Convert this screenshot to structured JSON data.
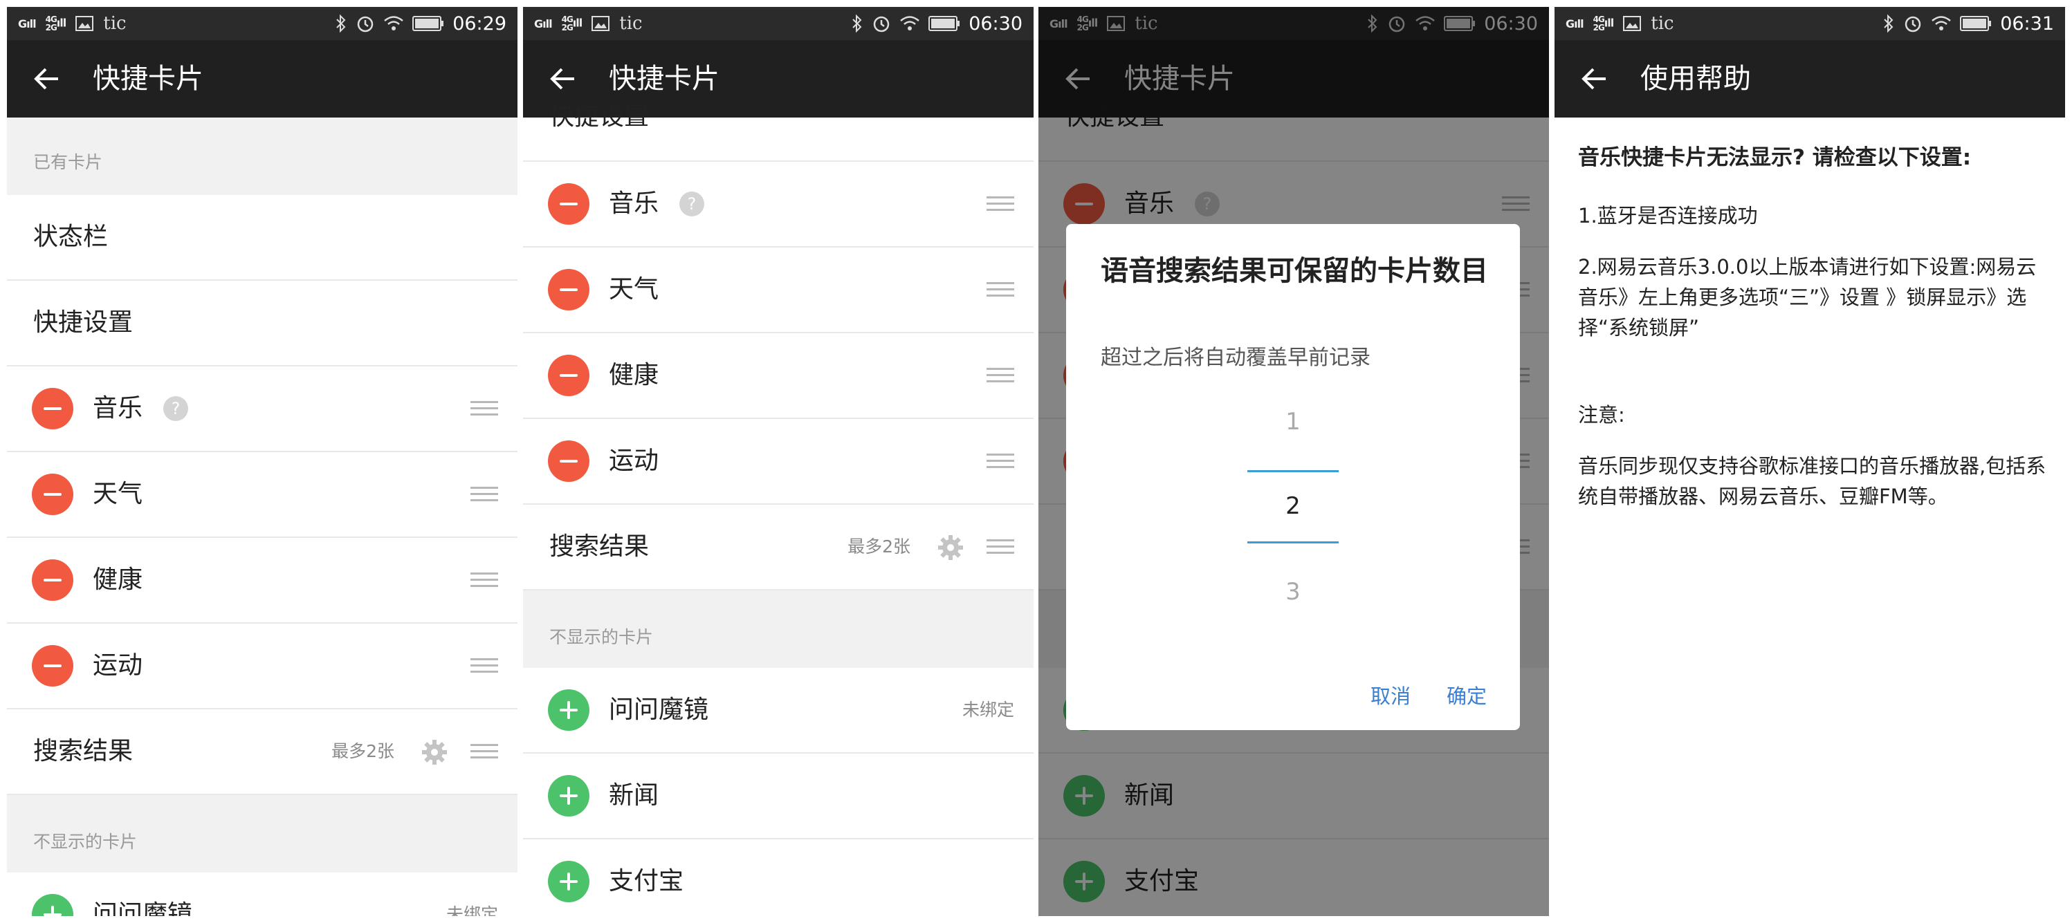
{
  "status_bar": {
    "carrier": "tic",
    "signal_label_1": "Gill",
    "signal_label_2": "4G",
    "signal_label_3": "2G"
  },
  "panel1": {
    "time": "06:29",
    "title": "快捷卡片",
    "section_existing": "已有卡片",
    "row_statusbar": "状态栏",
    "row_quick": "快捷设置",
    "cards": [
      "音乐",
      "天气",
      "健康",
      "运动"
    ],
    "help_mark": "?",
    "search_label": "搜索结果",
    "search_max": "最多2张",
    "section_hidden": "不显示的卡片",
    "hidden_first": "问问魔镜",
    "unbound": "未绑定"
  },
  "panel2": {
    "time": "06:30",
    "title": "快捷卡片",
    "partial_top": "快捷设置",
    "cards": [
      "音乐",
      "天气",
      "健康",
      "运动"
    ],
    "help_mark": "?",
    "search_label": "搜索结果",
    "search_max": "最多2张",
    "section_hidden": "不显示的卡片",
    "hidden_cards": [
      "问问魔镜",
      "新闻",
      "支付宝"
    ],
    "unbound": "未绑定"
  },
  "panel3": {
    "time": "06:30",
    "title": "快捷卡片",
    "partial_top": "快捷设置",
    "card_music": "音乐",
    "help_mark": "?",
    "hidden_cards": [
      "新闻",
      "支付宝"
    ],
    "dialog": {
      "title": "语音搜索结果可保留的卡片数目",
      "message": "超过之后将自动覆盖早前记录",
      "options": [
        "1",
        "2",
        "3"
      ],
      "cancel": "取消",
      "confirm": "确定"
    }
  },
  "panel4": {
    "time": "06:31",
    "title": "使用帮助",
    "heading": "音乐快捷卡片无法显示? 请检查以下设置:",
    "line1": "1.蓝牙是否连接成功",
    "line2": "2.网易云音乐3.0.0以上版本请进行如下设置:网易云音乐》左上角更多选项“三”》设置 》锁屏显示》选择“系统锁屏”",
    "note_label": "注意:",
    "note": "音乐同步现仅支持谷歌标准接口的音乐播放器,包括系统自带播放器、网易云音乐、豆瓣FM等。"
  },
  "colors": {
    "minus": "#f15a40",
    "plus": "#4cc36a",
    "dialog_button": "#3a7fd0",
    "picker_line": "#3e9bd9",
    "toolbar": "#202020"
  }
}
